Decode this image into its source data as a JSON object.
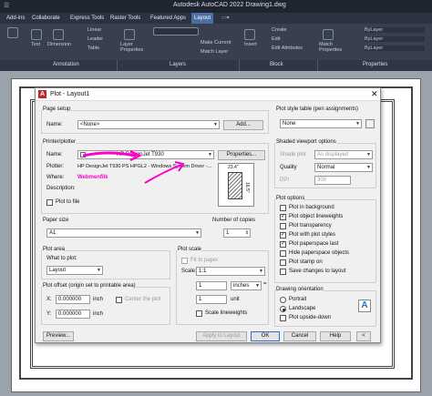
{
  "app": {
    "title": "Autodesk AutoCAD 2022   Drawing1.dwg"
  },
  "tabs": [
    "Add-ins",
    "Collaborate",
    "Express Tools",
    "Raster Tools",
    "Featured Apps",
    "Layout"
  ],
  "active_tab": "Layout",
  "ribbon": {
    "annotation_items": [
      "Text",
      "Dimension",
      "Linear",
      "Leader",
      "Table"
    ],
    "layer_items": [
      "Layer Properties",
      "Make Current",
      "Match Layer"
    ],
    "block_items": [
      "Insert",
      "Create",
      "Edit",
      "Edit Attributes"
    ],
    "properties_items": [
      "Match Properties",
      "ByLayer",
      "ByLayer",
      "ByLayer"
    ],
    "panels": [
      "Annotation",
      "Layers",
      "Block",
      "Properties"
    ]
  },
  "dialog": {
    "title": "Plot - Layout1",
    "page_setup": {
      "group": "Page setup",
      "name_label": "Name:",
      "name_value": "<None>",
      "add_button": "Add..."
    },
    "printer": {
      "group": "Printer/plotter",
      "name_label": "Name:",
      "name_value": "HP DesignJet T930",
      "properties_button": "Properties...",
      "plotter_label": "Plotter:",
      "plotter_value": "HP DesignJet T930 PS HPGL2 - Windows System Driver -...",
      "where_label": "Where:",
      "where_value": "Webmenfilk",
      "description_label": "Description:",
      "plot_to_file": "Plot to file",
      "preview_width": "23.4\"",
      "preview_height": "16.5\""
    },
    "paper_size": {
      "group": "Paper size",
      "value": "A1"
    },
    "copies": {
      "group": "Number of copies",
      "value": "1"
    },
    "plot_area": {
      "group": "Plot area",
      "what_label": "What to plot:",
      "value": "Layout"
    },
    "plot_scale": {
      "group": "Plot scale",
      "fit_to_paper": "Fit to paper",
      "scale_label": "Scale:",
      "scale_value": "1:1",
      "num1": "1",
      "unit1": "inches",
      "num2": "1",
      "unit2": "unit",
      "scale_lineweights": "Scale lineweights"
    },
    "plot_offset": {
      "group": "Plot offset (origin set to printable area)",
      "x_label": "X:",
      "x_value": "0.000000",
      "x_unit": "inch",
      "y_label": "Y:",
      "y_value": "0.000000",
      "y_unit": "inch",
      "center": "Center the plot"
    },
    "style_table": {
      "group": "Plot style table (pen assignments)",
      "value": "None"
    },
    "shaded": {
      "group": "Shaded viewport options",
      "shade_label": "Shade plot",
      "shade_value": "As displayed",
      "quality_label": "Quality",
      "quality_value": "Normal",
      "dpi_label": "DPI",
      "dpi_value": "300"
    },
    "plot_options": {
      "group": "Plot options",
      "items": [
        {
          "label": "Plot in background",
          "checked": false
        },
        {
          "label": "Plot object lineweights",
          "checked": true
        },
        {
          "label": "Plot transparency",
          "checked": false
        },
        {
          "label": "Plot with plot styles",
          "checked": true
        },
        {
          "label": "Plot paperspace last",
          "checked": true
        },
        {
          "label": "Hide paperspace objects",
          "checked": false
        },
        {
          "label": "Plot stamp on",
          "checked": false
        },
        {
          "label": "Save changes to layout",
          "checked": false
        }
      ]
    },
    "orientation": {
      "group": "Drawing orientation",
      "portrait": "Portrait",
      "landscape": "Landscape",
      "upside_down": "Plot upside-down",
      "selected": "landscape"
    },
    "buttons": {
      "preview": "Preview...",
      "apply": "Apply to Layout",
      "ok": "OK",
      "cancel": "Cancel",
      "help": "Help"
    }
  },
  "colors": {
    "accent": "#2a6fd4",
    "annotation": "#ff00cc"
  }
}
